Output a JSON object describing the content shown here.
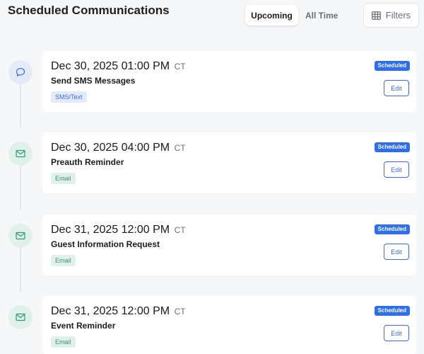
{
  "header": {
    "title": "Scheduled Communications",
    "tabs": [
      {
        "label": "Upcoming",
        "active": true
      },
      {
        "label": "All Time",
        "active": false
      }
    ],
    "filters_label": "Filters",
    "filters_icon": "table-icon"
  },
  "events": [
    {
      "datetime": "Dec 30, 2025 01:00 PM",
      "timezone": "CT",
      "name": "Send SMS Messages",
      "channel": "SMS/Text",
      "channel_icon": "chat-bubble-icon",
      "status": "Scheduled",
      "edit_label": "Edit"
    },
    {
      "datetime": "Dec 30, 2025 04:00 PM",
      "timezone": "CT",
      "name": "Preauth Reminder",
      "channel": "Email",
      "channel_icon": "envelope-icon",
      "status": "Scheduled",
      "edit_label": "Edit"
    },
    {
      "datetime": "Dec 31, 2025 12:00 PM",
      "timezone": "CT",
      "name": "Guest Information Request",
      "channel": "Email",
      "channel_icon": "envelope-icon",
      "status": "Scheduled",
      "edit_label": "Edit"
    },
    {
      "datetime": "Dec 31, 2025 12:00 PM",
      "timezone": "CT",
      "name": "Event Reminder",
      "channel": "Email",
      "channel_icon": "envelope-icon",
      "status": "Scheduled",
      "edit_label": "Edit"
    }
  ],
  "colors": {
    "accent": "#2f6fed",
    "sms": "#3f6ad8",
    "email": "#2f9b6d"
  }
}
